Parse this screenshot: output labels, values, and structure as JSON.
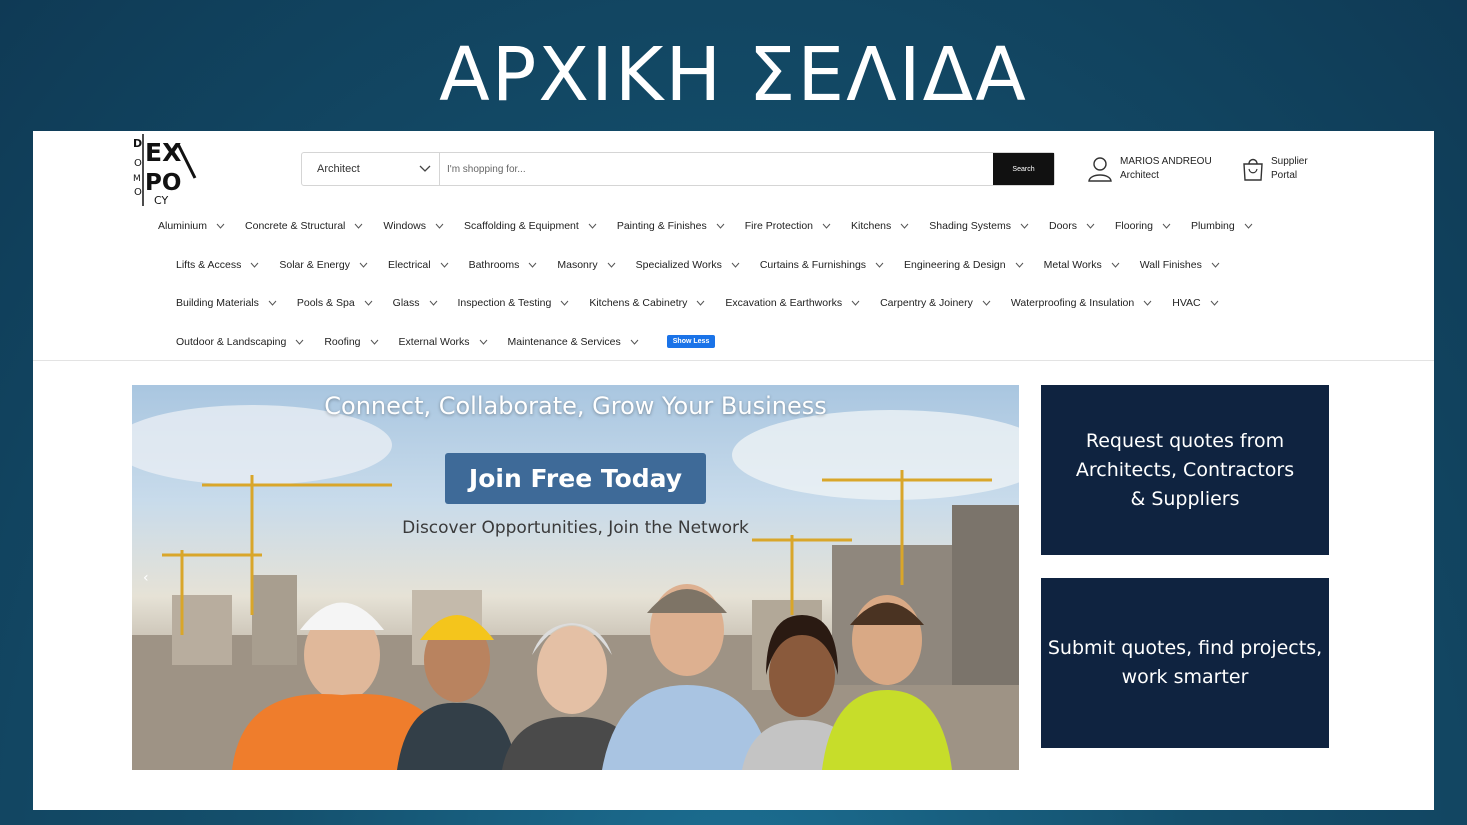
{
  "slide": {
    "title": "ΑΡΧΙΚΗ ΣΕΛΙΔΑ"
  },
  "header": {
    "logo_letters": [
      "D",
      "O",
      "M",
      "O",
      "EX",
      "PO",
      "CY"
    ],
    "search": {
      "category": "Architect",
      "placeholder": "I'm shopping for...",
      "button": "Search"
    },
    "user": {
      "name": "MARIOS ANDREOU",
      "role": "Architect"
    },
    "supplier": {
      "line1": "Supplier",
      "line2": "Portal"
    }
  },
  "categories": {
    "row1": [
      "Aluminium",
      "Concrete & Structural",
      "Windows",
      "Scaffolding & Equipment",
      "Painting & Finishes",
      "Fire Protection",
      "Kitchens",
      "Shading Systems",
      "Doors",
      "Flooring",
      "Plumbing"
    ],
    "row2": [
      "Lifts & Access",
      "Solar & Energy",
      "Electrical",
      "Bathrooms",
      "Masonry",
      "Specialized Works",
      "Curtains & Furnishings",
      "Engineering & Design",
      "Metal Works",
      "Wall Finishes"
    ],
    "row3": [
      "Building Materials",
      "Pools & Spa",
      "Glass",
      "Inspection & Testing",
      "Kitchens & Cabinetry",
      "Excavation & Earthworks",
      "Carpentry & Joinery",
      "Waterproofing & Insulation",
      "HVAC"
    ],
    "row4": [
      "Outdoor & Landscaping",
      "Roofing",
      "External Works",
      "Maintenance & Services"
    ],
    "show_less": "Show Less"
  },
  "banner": {
    "headline": "Connect, Collaborate, Grow Your Business",
    "cta": "Join Free Today",
    "subline": "Discover Opportunities, Join the Network",
    "prev_arrow": "‹"
  },
  "cards": [
    {
      "text": "Request quotes from\nArchitects, Contractors\n& Suppliers"
    },
    {
      "text": "Submit quotes, find projects,\nwork smarter"
    }
  ],
  "colors": {
    "slide_bg": "#14506d",
    "card_bg": "#0f2340",
    "cta_bg": "#3e6a98",
    "show_less_bg": "#1a73e8",
    "search_button_bg": "#111111"
  }
}
